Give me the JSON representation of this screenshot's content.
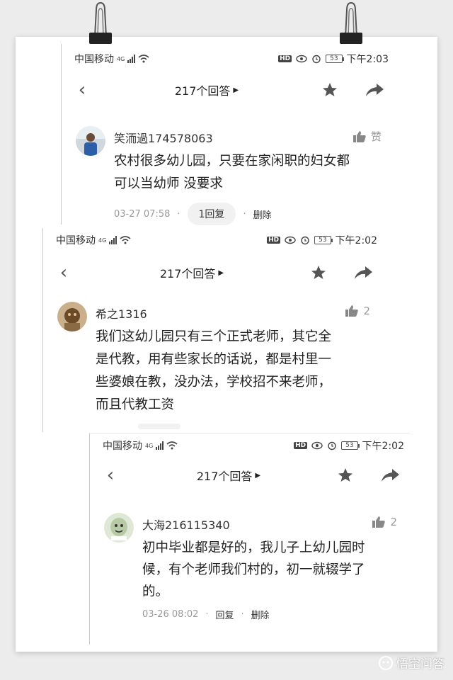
{
  "shots": [
    {
      "status": {
        "carrier": "中国移动",
        "network": "4G",
        "battery": "53",
        "time": "下午2:03"
      },
      "nav": {
        "title": "217个回答"
      },
      "comment": {
        "username": "笑洏過174578063",
        "like_label": "赞",
        "lines": [
          "农村很多幼儿园，只要在家闲职的妇女都",
          "可以当幼师 没要求"
        ],
        "time": "03-27 07:58",
        "reply": "1回复",
        "delete": "删除"
      }
    },
    {
      "status": {
        "carrier": "中国移动",
        "network": "4G",
        "battery": "53",
        "time": "下午2:02"
      },
      "nav": {
        "title": "217个回答"
      },
      "comment": {
        "username": "希之1316",
        "like_count": "2",
        "lines": [
          "我们这幼儿园只有三个正式老师，其它全",
          "是代教，用有些家长的话说，都是村里一",
          "些婆娘在教，没办法，学校招不来老师，",
          "而且代教工资"
        ]
      }
    },
    {
      "status": {
        "carrier": "中国移动",
        "network": "4G",
        "battery": "53",
        "time": "下午2:02"
      },
      "nav": {
        "title": "217个回答"
      },
      "comment": {
        "username": "大海216115340",
        "like_count": "2",
        "lines": [
          "初中毕业都是好的，我儿子上幼儿园时",
          "候，有个老师我们村的，初一就辍学了",
          "的。"
        ],
        "time": "03-26 08:02",
        "reply": "回复",
        "delete": "删除"
      }
    }
  ],
  "watermark": "悟空问答",
  "icons": {
    "back": "chevron-left-icon",
    "star": "star-icon",
    "share": "share-arrow-icon",
    "like": "thumbs-up-icon",
    "wifi": "wifi-icon",
    "signal": "signal-icon",
    "eye": "eye-icon",
    "alarm": "alarm-icon"
  }
}
